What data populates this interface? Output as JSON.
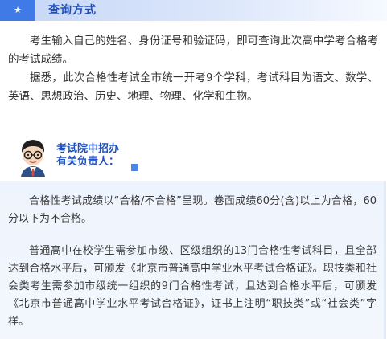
{
  "section": {
    "icon": "star-icon",
    "title": "查询方式"
  },
  "body": {
    "paragraphs": [
      "考生输入自己的姓名、身份证号和验证码，即可查询此次高中学考合格考的考试成绩。",
      "据悉，此次合格性考试全市统一开考9个学科，考试科目为语文、数学、英语、思想政治、历史、地理、物理、化学和生物。"
    ]
  },
  "speaker": {
    "avatar": "official-avatar-icon",
    "label_line1": "考试院中招办",
    "label_line2": "有关负责人："
  },
  "answer": {
    "paragraphs": [
      "合格性考试成绩以“合格/不合格”呈现。卷面成绩60分(含)以上为合格，60分以下为不合格。",
      "普通高中在校学生需参加市级、区级组织的13门合格性考试科目，且全部达到合格水平后，可颁发《北京市普通高中学业水平考试合格证》。职技类和社会类考生需参加市级统一组织的9门合格性考试，且达到合格水平后，可颁发《北京市普通高中学业水平考试合格证》，证书上注明“职技类”或“社会类”字样。"
    ]
  },
  "colors": {
    "accent": "#3f7ae6",
    "title": "#1e4fbf",
    "answer_bg": "#eef4fd"
  }
}
